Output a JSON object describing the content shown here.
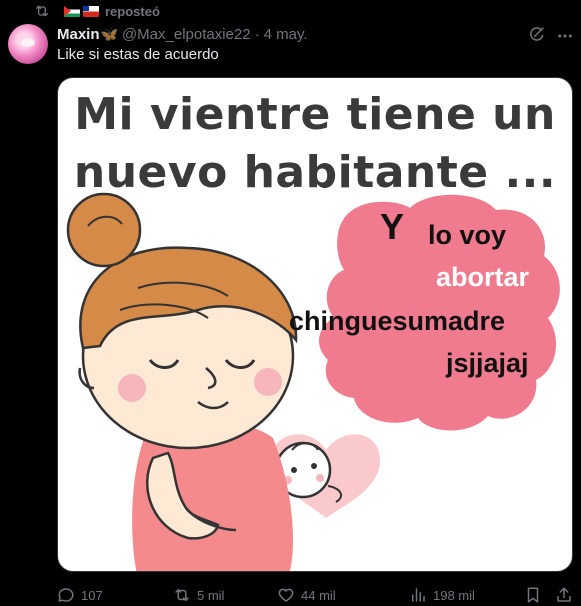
{
  "repost": {
    "label": "reposteó",
    "icon": "repost-icon",
    "flags": [
      "palestine-flag",
      "chile-flag"
    ]
  },
  "tweet": {
    "author_name": "Maxin",
    "author_emoji": "🦋",
    "handle": "@Max_elpotaxie22",
    "separator": "·",
    "date": "4 may.",
    "text": "Like si estas de acuerdo"
  },
  "meme": {
    "title_line1": "Mi vientre tiene un",
    "title_line2": "nuevo habitante ...",
    "y": "Y",
    "line1": "lo voy",
    "line2": "abortar",
    "line3": "chinguesumadre",
    "line4": "jsjjajaj",
    "colors": {
      "pink": "#f07b8f",
      "hair": "#d68a47",
      "skin": "#fde9d4"
    }
  },
  "actions": {
    "replies": "107",
    "reposts": "5 mil",
    "likes": "44 mil",
    "views": "198 mil"
  },
  "colors": {
    "background": "#000000",
    "muted": "#71767b",
    "text": "#e7e9ea"
  }
}
